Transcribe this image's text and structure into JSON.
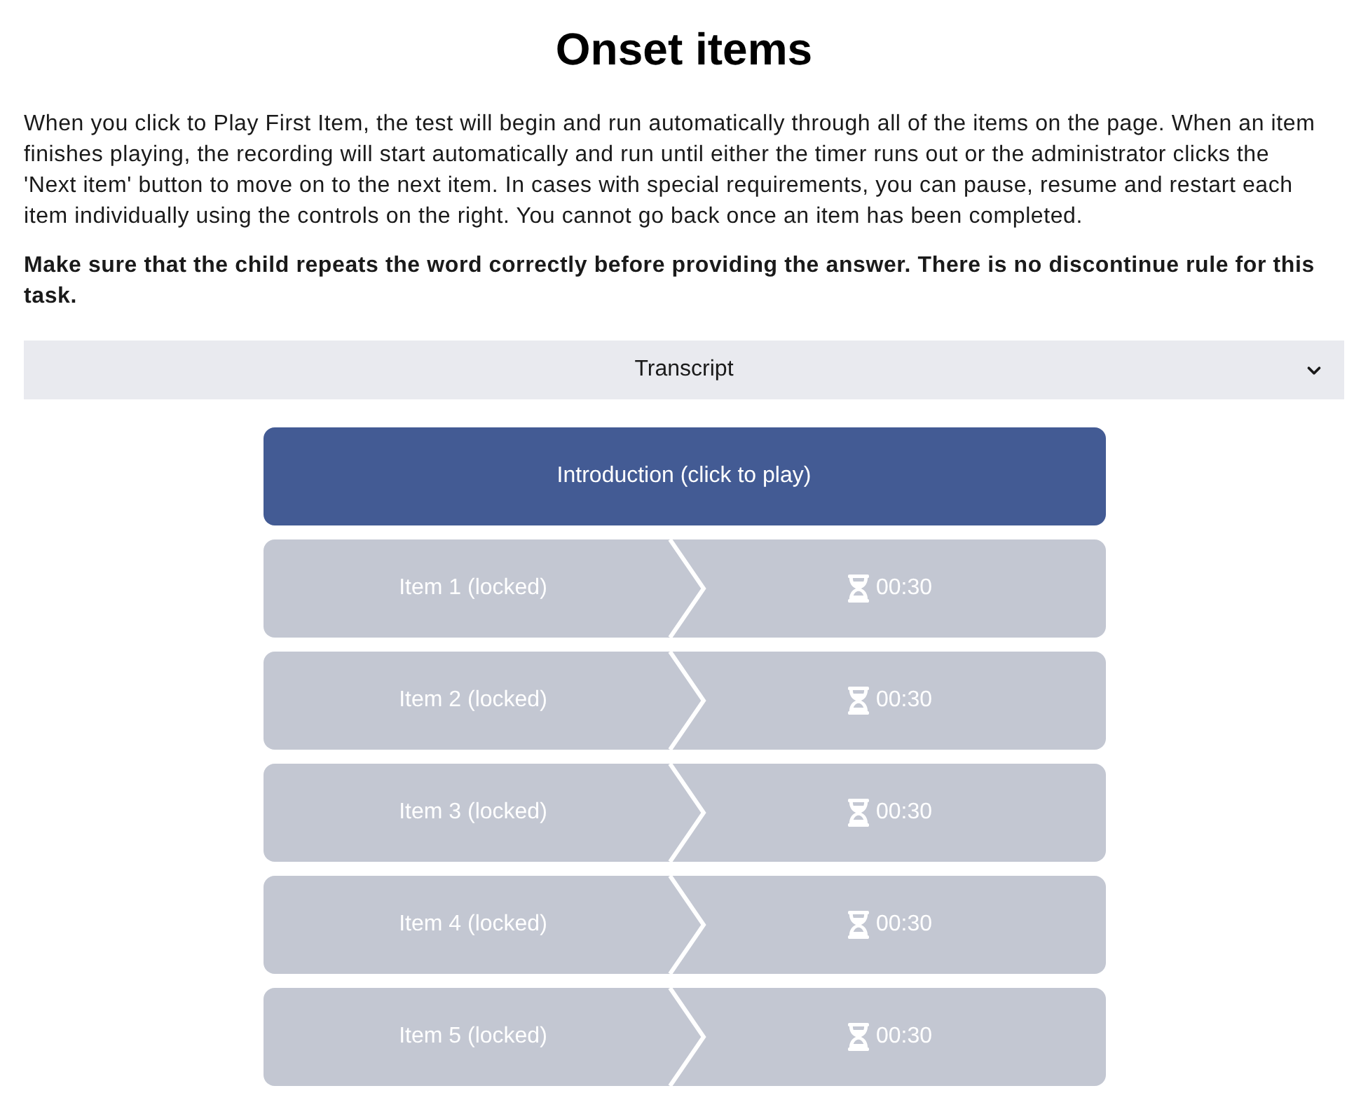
{
  "title": "Onset items",
  "instructions": [
    "When you click to Play First Item, the test will begin and run automatically through all of the items on the page. When an item finishes playing, the recording will start automatically and run until either the timer runs out or the administrator clicks the 'Next item' button to move on to the next item. In cases with special requirements, you can pause, resume and restart each item individually using the controls on the right. You cannot go back once an item has been completed."
  ],
  "note": "Make sure that the child repeats the word correctly before providing the answer. There is no discontinue rule for this task.",
  "transcript": {
    "label": "Transcript",
    "expanded": false
  },
  "introduction": {
    "label": "Introduction (click to play)"
  },
  "items": [
    {
      "label": "Item 1 (locked)",
      "locked": true,
      "timer": "00:30"
    },
    {
      "label": "Item 2 (locked)",
      "locked": true,
      "timer": "00:30"
    },
    {
      "label": "Item 3 (locked)",
      "locked": true,
      "timer": "00:30"
    },
    {
      "label": "Item 4 (locked)",
      "locked": true,
      "timer": "00:30"
    },
    {
      "label": "Item 5 (locked)",
      "locked": true,
      "timer": "00:30"
    }
  ]
}
